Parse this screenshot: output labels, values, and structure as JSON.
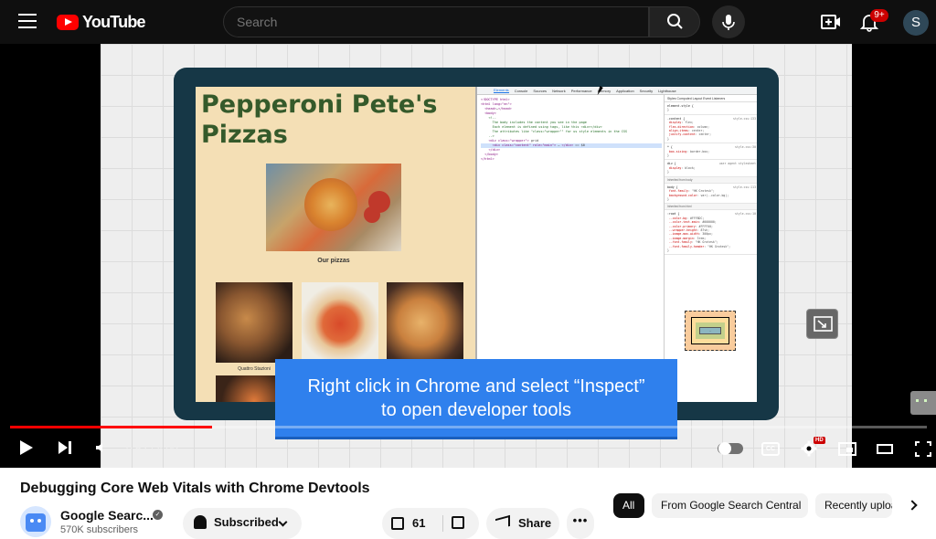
{
  "header": {
    "logo_text": "YouTube",
    "search_placeholder": "Search",
    "notification_count": "9+",
    "avatar_letter": "S"
  },
  "video": {
    "site_title": "Pepperoni Pete's Pizzas",
    "our_pizzas": "Our pizzas",
    "photo_caption": "Quattro Stazioni",
    "devtools_tabs": [
      "Elements",
      "Console",
      "Sources",
      "Network",
      "Performance",
      "Memory",
      "Application",
      "Security",
      "Lighthouse"
    ],
    "devtools_side_tabs": "Styles  Computed  Layout  Event Listeners",
    "subtitle_line1": "Right click in Chrome and select “Inspect”",
    "subtitle_line2": "to open developer tools"
  },
  "player": {
    "time": "0:52 / 4:00",
    "progress_fraction": 0.22,
    "hd_badge": "HD",
    "cc_label": "CC"
  },
  "meta": {
    "title": "Debugging Core Web Vitals with Chrome Devtools",
    "channel_name": "Google Searc...",
    "subscribers": "570K subscribers",
    "subscribed_label": "Subscribed",
    "like_count": "61",
    "share_label": "Share",
    "more_label": "•••"
  },
  "chips": {
    "all": "All",
    "from_channel": "From Google Search Central",
    "recently": "Recently uploaded"
  },
  "colors": {
    "brand_red": "#ff0000",
    "subtitle_blue": "#2f80ed",
    "site_green": "#355a2b",
    "laptop_frame": "#163746"
  }
}
